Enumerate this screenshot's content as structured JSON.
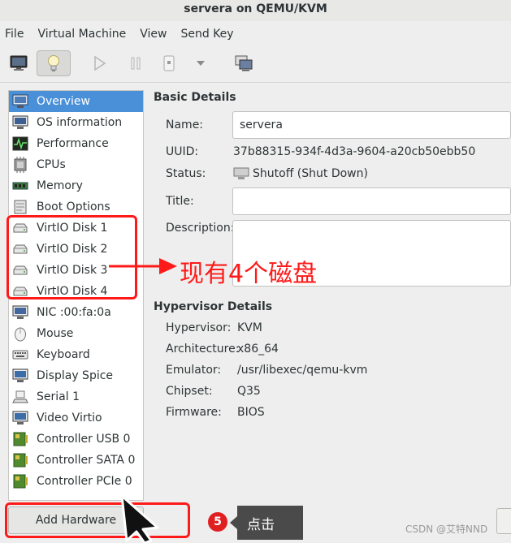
{
  "window": {
    "title": "servera on QEMU/KVM"
  },
  "menubar": {
    "items": [
      "File",
      "Virtual Machine",
      "View",
      "Send Key"
    ]
  },
  "sidebar": {
    "items": [
      {
        "label": "Overview",
        "icon": "overview-icon",
        "selected": true
      },
      {
        "label": "OS information",
        "icon": "os-information-icon"
      },
      {
        "label": "Performance",
        "icon": "performance-icon"
      },
      {
        "label": "CPUs",
        "icon": "cpu-icon"
      },
      {
        "label": "Memory",
        "icon": "memory-icon"
      },
      {
        "label": "Boot Options",
        "icon": "boot-options-icon"
      },
      {
        "label": "VirtIO Disk 1",
        "icon": "disk-icon"
      },
      {
        "label": "VirtIO Disk 2",
        "icon": "disk-icon"
      },
      {
        "label": "VirtIO Disk 3",
        "icon": "disk-icon"
      },
      {
        "label": "VirtIO Disk 4",
        "icon": "disk-icon"
      },
      {
        "label": "NIC :00:fa:0a",
        "icon": "nic-icon"
      },
      {
        "label": "Mouse",
        "icon": "mouse-icon"
      },
      {
        "label": "Keyboard",
        "icon": "keyboard-icon"
      },
      {
        "label": "Display Spice",
        "icon": "display-icon"
      },
      {
        "label": "Serial 1",
        "icon": "serial-icon"
      },
      {
        "label": "Video Virtio",
        "icon": "video-icon"
      },
      {
        "label": "Controller USB 0",
        "icon": "controller-icon"
      },
      {
        "label": "Controller SATA 0",
        "icon": "controller-icon"
      },
      {
        "label": "Controller PCIe 0",
        "icon": "controller-icon"
      }
    ],
    "add_hardware_label": "Add Hardware"
  },
  "basic_details": {
    "title": "Basic Details",
    "name_label": "Name:",
    "name_value": "servera",
    "uuid_label": "UUID:",
    "uuid_value": "37b88315-934f-4d3a-9604-a20cb50ebb50",
    "status_label": "Status:",
    "status_value": "Shutoff (Shut Down)",
    "title_label": "Title:",
    "title_value": "",
    "description_label": "Description:",
    "description_value": ""
  },
  "hypervisor_details": {
    "title": "Hypervisor Details",
    "hypervisor_label": "Hypervisor:",
    "hypervisor_value": "KVM",
    "architecture_label": "Architecture:",
    "architecture_value": "x86_64",
    "emulator_label": "Emulator:",
    "emulator_value": "/usr/libexec/qemu-kvm",
    "chipset_label": "Chipset:",
    "chipset_value": "Q35",
    "firmware_label": "Firmware:",
    "firmware_value": "BIOS"
  },
  "annotations": {
    "disk_note": "现有4个磁盘",
    "step_number": "5",
    "click_note": "点击",
    "watermark": "CSDN @艾特NND"
  },
  "colors": {
    "selection": "#4a90d9",
    "annotation_red": "#ff1a1a"
  }
}
